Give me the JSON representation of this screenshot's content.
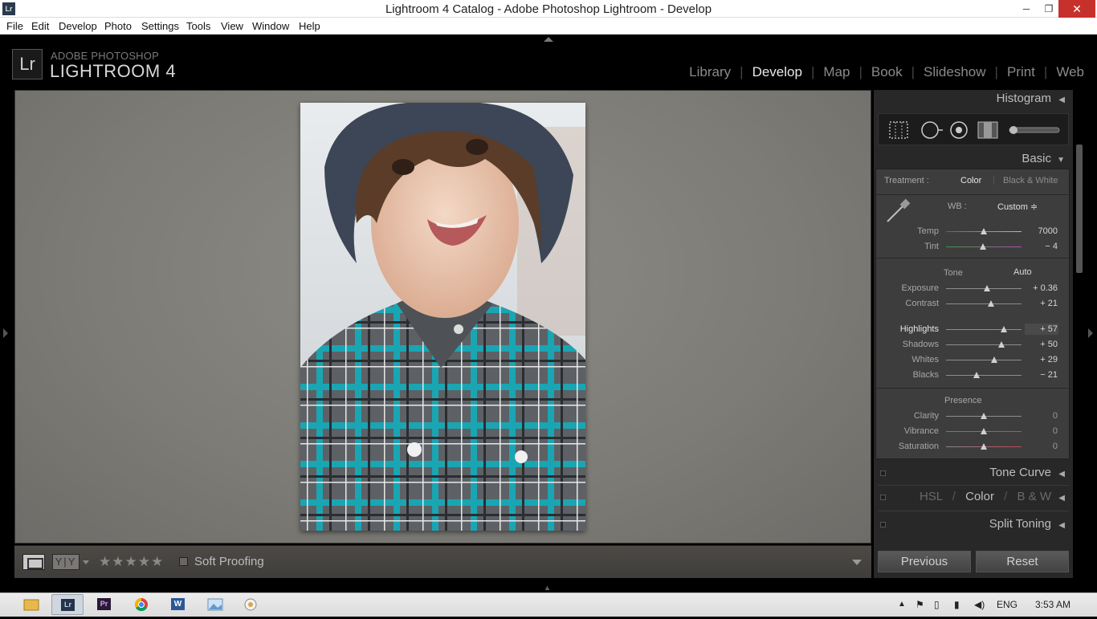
{
  "window": {
    "title": "Lightroom 4 Catalog - Adobe Photoshop Lightroom - Develop",
    "minimize_label": "─",
    "maximize_label": "❐",
    "close_label": "✕"
  },
  "menu": [
    "File",
    "Edit",
    "Develop",
    "Photo",
    "Settings",
    "Tools",
    "View",
    "Window",
    "Help"
  ],
  "branding": {
    "logo_text": "Lr",
    "line1": "ADOBE PHOTOSHOP",
    "line2": "LIGHTROOM 4"
  },
  "modules": [
    "Library",
    "Develop",
    "Map",
    "Book",
    "Slideshow",
    "Print",
    "Web"
  ],
  "active_module": "Develop",
  "toolbar": {
    "yy_label": "Y|Y",
    "stars": "★★★★★",
    "soft_proofing_label": "Soft Proofing"
  },
  "panels": {
    "histogram": "Histogram",
    "basic": "Basic",
    "tone_curve": "Tone Curve",
    "hsl": {
      "hsl": "HSL",
      "color": "Color",
      "bw": "B & W",
      "sep": "/"
    },
    "split_toning": "Split Toning"
  },
  "basic": {
    "treatment_label": "Treatment :",
    "treatment_color": "Color",
    "treatment_bw": "Black & White",
    "wb_label": "WB :",
    "wb_value": "Custom ≑",
    "tone_label": "Tone",
    "auto_label": "Auto",
    "presence_label": "Presence",
    "sliders": [
      {
        "label": "Temp",
        "value": "7000",
        "pos": 0.5,
        "highlight": false
      },
      {
        "label": "Tint",
        "value": "− 4",
        "pos": 0.49,
        "highlight": false
      },
      {
        "label": "Exposure",
        "value": "+ 0.36",
        "pos": 0.54,
        "highlight": false
      },
      {
        "label": "Contrast",
        "value": "+ 21",
        "pos": 0.6,
        "highlight": false
      },
      {
        "label": "Highlights",
        "value": "+ 57",
        "pos": 0.77,
        "highlight": true
      },
      {
        "label": "Shadows",
        "value": "+ 50",
        "pos": 0.73,
        "highlight": false
      },
      {
        "label": "Whites",
        "value": "+ 29",
        "pos": 0.64,
        "highlight": false
      },
      {
        "label": "Blacks",
        "value": "− 21",
        "pos": 0.4,
        "highlight": false
      },
      {
        "label": "Clarity",
        "value": "0",
        "pos": 0.5,
        "highlight": false
      },
      {
        "label": "Vibrance",
        "value": "0",
        "pos": 0.5,
        "highlight": false
      },
      {
        "label": "Saturation",
        "value": "0",
        "pos": 0.5,
        "highlight": false
      }
    ]
  },
  "buttons": {
    "previous": "Previous",
    "reset": "Reset"
  },
  "taskbar": {
    "lang": "ENG",
    "time": "3:53 AM",
    "apps": [
      "file-explorer",
      "lightroom",
      "premiere",
      "chrome",
      "word",
      "image-viewer",
      "control-panel"
    ],
    "app_labels": {
      "lightroom": "Lr",
      "premiere": "Pr",
      "word": "W"
    }
  }
}
